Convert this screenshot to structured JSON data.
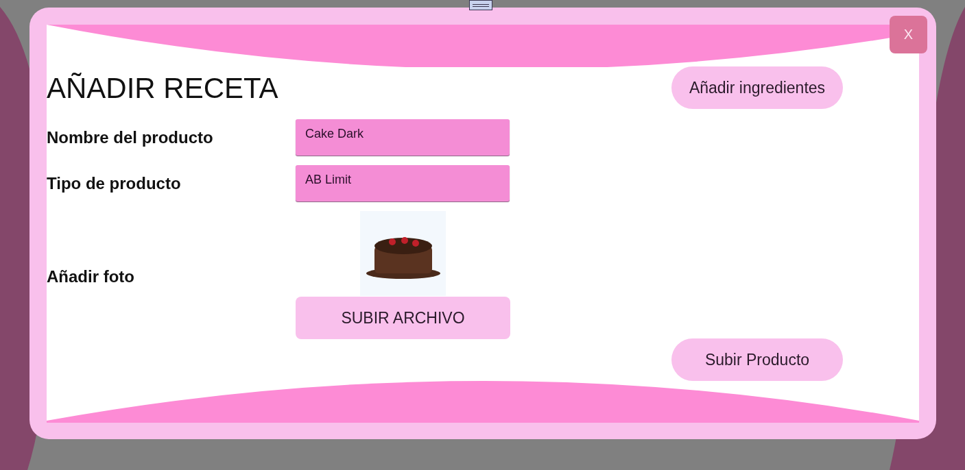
{
  "close_button": {
    "label": "X"
  },
  "title": "AÑADIR RECETA",
  "fields": [
    {
      "label": "Nombre del producto",
      "value": "Cake Dark"
    },
    {
      "label": "Tipo de producto",
      "value": "AB Limit"
    }
  ],
  "photo": {
    "label": "Añadir foto",
    "upload_button": "SUBIR ARCHIVO"
  },
  "buttons": [
    {
      "label": "Añadir ingredientes"
    },
    {
      "label": "Subir Producto"
    }
  ]
}
